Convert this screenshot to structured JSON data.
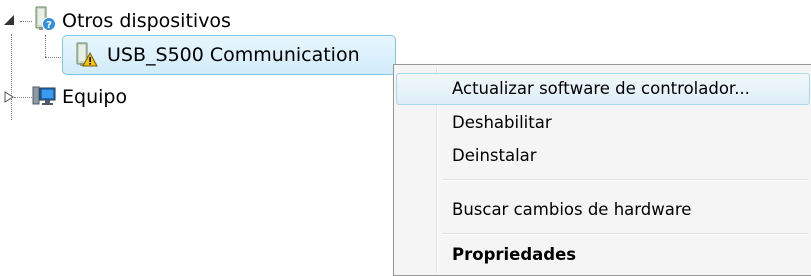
{
  "tree": {
    "items": [
      {
        "label": "Otros dispositivos",
        "expanded": true,
        "icon": "unknown-device-icon"
      },
      {
        "label": "USB_S500 Communication",
        "selected": true,
        "icon": "warning-device-icon"
      },
      {
        "label": "Equipo",
        "expanded": false,
        "icon": "computer-icon"
      }
    ]
  },
  "context_menu": {
    "items": [
      {
        "label": "Actualizar software de controlador...",
        "highlighted": true
      },
      {
        "label": "Deshabilitar"
      },
      {
        "label": "Deinstalar"
      },
      {
        "label": "Buscar cambios de hardware"
      },
      {
        "label": "Propriedades",
        "bold": true
      }
    ]
  },
  "colors": {
    "selection_border": "#7fc6ea",
    "selection_fill": "#d9effa",
    "menu_background": "#f5f5f5",
    "menu_hover_border": "#a8d8eb"
  }
}
